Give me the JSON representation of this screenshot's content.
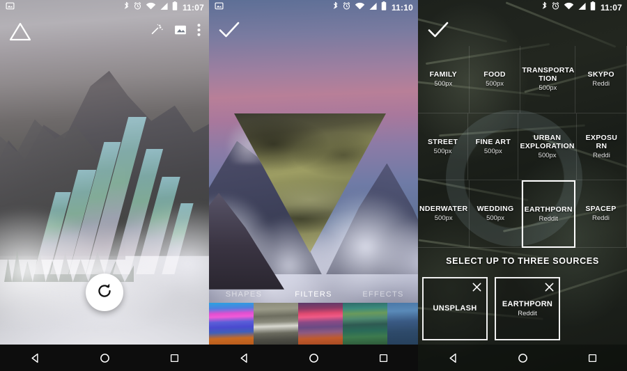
{
  "screens": [
    {
      "id": "editor",
      "statusbar": {
        "time": "11:07",
        "icons": [
          "screenshot-icon",
          "bluetooth-icon",
          "alarm-icon",
          "wifi-icon",
          "cellular-icon",
          "battery-icon"
        ]
      },
      "appbar": {
        "logo": "triangle-logo",
        "actions": [
          "magic-wand-icon",
          "gallery-icon",
          "overflow-menu-icon"
        ]
      },
      "fab": {
        "icon": "refresh-icon"
      },
      "navbar": {
        "back": "back-icon",
        "home": "home-icon",
        "recents": "recents-icon"
      }
    },
    {
      "id": "filters",
      "statusbar": {
        "time": "11:10",
        "icons": [
          "screenshot-icon",
          "bluetooth-icon",
          "alarm-icon",
          "wifi-icon",
          "cellular-icon",
          "battery-icon"
        ]
      },
      "appbar": {
        "confirm": "check-icon"
      },
      "tabs": [
        {
          "label": "SHAPES",
          "active": false
        },
        {
          "label": "FILTERS",
          "active": true
        },
        {
          "label": "EFFECTS",
          "active": false
        }
      ],
      "thumbnails": [
        {
          "name": "filter-magenta",
          "selected": false
        },
        {
          "name": "filter-olive",
          "selected": true
        },
        {
          "name": "filter-crimson",
          "selected": false
        },
        {
          "name": "filter-teal",
          "selected": false
        },
        {
          "name": "filter-blue",
          "selected": false
        }
      ],
      "navbar": {
        "back": "back-icon",
        "home": "home-icon",
        "recents": "recents-icon"
      }
    },
    {
      "id": "sources",
      "statusbar": {
        "time": "11:07",
        "icons": [
          "bluetooth-icon",
          "alarm-icon",
          "wifi-icon",
          "cellular-icon",
          "battery-icon"
        ]
      },
      "appbar": {
        "confirm": "check-icon"
      },
      "grid": [
        [
          {
            "name": "FAMILY",
            "source": "500px",
            "selected": false
          },
          {
            "name": "FOOD",
            "source": "500px",
            "selected": false
          },
          {
            "name": "TRANSPORTA TION",
            "source": "500px",
            "selected": false
          },
          {
            "name": "SKYPO",
            "source": "Reddi",
            "selected": false
          }
        ],
        [
          {
            "name": "STREET",
            "source": "500px",
            "selected": false
          },
          {
            "name": "FINE ART",
            "source": "500px",
            "selected": false
          },
          {
            "name": "URBAN EXPLORATION",
            "source": "500px",
            "selected": false
          },
          {
            "name": "EXPOSU RN",
            "source": "Reddi",
            "selected": false
          }
        ],
        [
          {
            "name": "NDERWATER",
            "source": "500px",
            "selected": false
          },
          {
            "name": "WEDDING",
            "source": "500px",
            "selected": false
          },
          {
            "name": "EARTHPORN",
            "source": "Reddit",
            "selected": true
          },
          {
            "name": "SPACEP",
            "source": "Reddi",
            "selected": false
          }
        ]
      ],
      "instruction": "SELECT UP TO THREE SOURCES",
      "selected_chips": [
        {
          "name": "UNSPLASH",
          "source": "",
          "close": "close-icon"
        },
        {
          "name": "EARTHPORN",
          "source": "Reddit",
          "close": "close-icon"
        }
      ],
      "navbar": {
        "back": "back-icon",
        "home": "home-icon",
        "recents": "recents-icon"
      }
    }
  ],
  "colors": {
    "accent_white": "#ffffff",
    "nav_bg": "#0d0d0d",
    "selected_border": "#ffffff",
    "inactive_tab": "rgba(255,255,255,0.55)"
  }
}
